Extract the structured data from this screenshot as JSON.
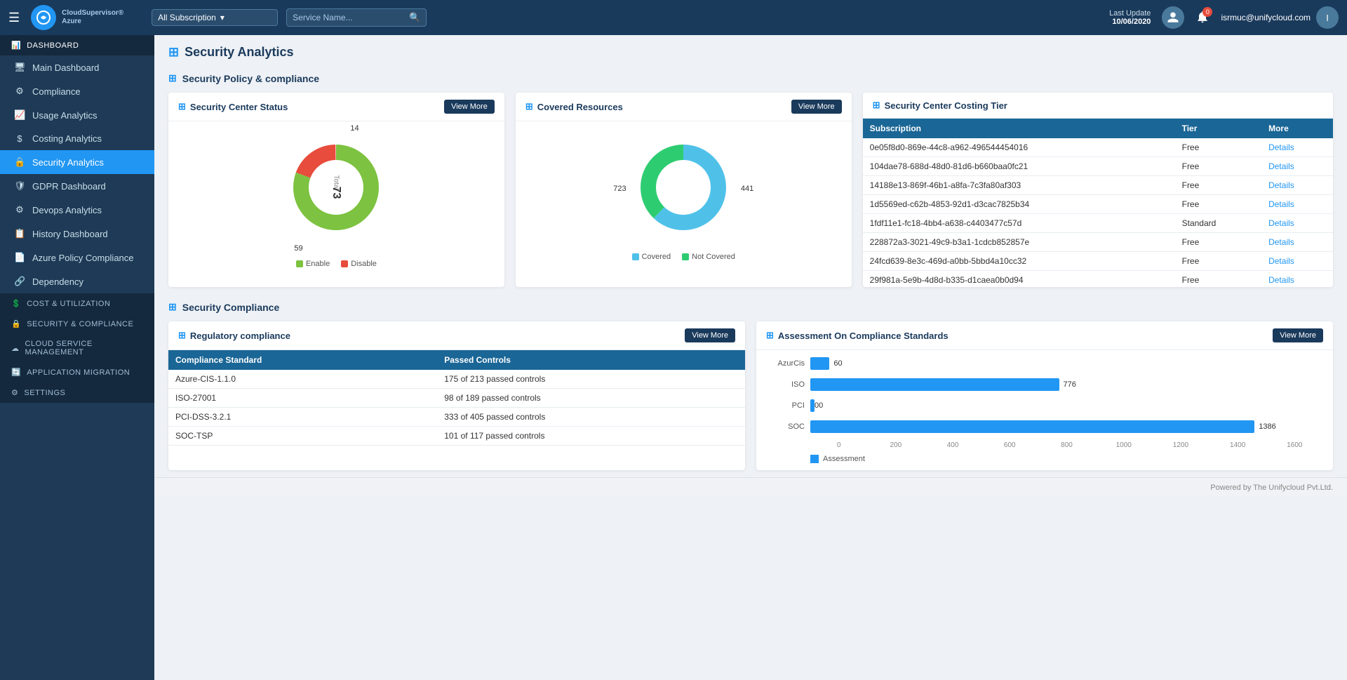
{
  "topnav": {
    "hamburger_icon": "☰",
    "logo_text": "CloudSupervisor®",
    "logo_sub": "Azure",
    "subscription_label": "All Subscription",
    "service_placeholder": "Service Name...",
    "last_update_label": "Last Update",
    "last_update_date": "10/06/2020",
    "username": "isrmuc@unifycloud.com",
    "bell_badge": "0"
  },
  "sidebar": {
    "dashboard_section": "Dashboard",
    "items": [
      {
        "id": "main-dashboard",
        "label": "Main Dashboard",
        "icon": "🖥"
      },
      {
        "id": "compliance",
        "label": "Compliance",
        "icon": "⚙"
      },
      {
        "id": "usage-analytics",
        "label": "Usage Analytics",
        "icon": "📈"
      },
      {
        "id": "costing-analytics",
        "label": "Costing Analytics",
        "icon": "$"
      },
      {
        "id": "security-analytics",
        "label": "Security Analytics",
        "icon": "🔒",
        "active": true
      },
      {
        "id": "gdpr-dashboard",
        "label": "GDPR Dashboard",
        "icon": "🛡"
      },
      {
        "id": "devops-analytics",
        "label": "Devops Analytics",
        "icon": "⚙"
      },
      {
        "id": "history-dashboard",
        "label": "History Dashboard",
        "icon": "📋"
      },
      {
        "id": "azure-policy",
        "label": "Azure Policy Compliance",
        "icon": "📄"
      },
      {
        "id": "dependency",
        "label": "Dependency",
        "icon": "🔗"
      }
    ],
    "sections": [
      {
        "id": "cost-utilization",
        "label": "Cost & Utilization",
        "icon": "💲"
      },
      {
        "id": "security-compliance",
        "label": "Security & Compliance",
        "icon": "🔒"
      },
      {
        "id": "cloud-service",
        "label": "Cloud Service Management",
        "icon": "☁"
      },
      {
        "id": "app-migration",
        "label": "Application Migration",
        "icon": "🔄"
      },
      {
        "id": "settings",
        "label": "Settings",
        "icon": "⚙"
      }
    ]
  },
  "page": {
    "title": "Security Analytics"
  },
  "security_policy_section": {
    "title": "Security Policy & compliance"
  },
  "security_center_status": {
    "card_title": "Security Center Status",
    "view_more": "View More",
    "total_label": "Total",
    "total_value": "73",
    "donut_segments": [
      {
        "label": "Enable",
        "value": 59,
        "color": "#7dc240",
        "percent": 80.8
      },
      {
        "label": "Disable",
        "value": 14,
        "color": "#e74c3c",
        "percent": 19.2
      }
    ],
    "label_enable": "Enable",
    "label_disable": "Disable",
    "value_top": "14",
    "value_bottom": "59"
  },
  "covered_resources": {
    "card_title": "Covered Resources",
    "view_more": "View More",
    "donut_segments": [
      {
        "label": "Covered",
        "value": 723,
        "color": "#4fc1e9",
        "percent": 62.1
      },
      {
        "label": "Not Covered",
        "value": 441,
        "color": "#2ecc71",
        "percent": 37.9
      }
    ],
    "label_covered": "Covered",
    "label_not_covered": "Not Covered",
    "value_left": "723",
    "value_right": "441"
  },
  "costing_tier": {
    "card_title": "Security Center Costing Tier",
    "col_subscription": "Subscription",
    "col_tier": "Tier",
    "col_more": "More",
    "rows": [
      {
        "subscription": "0e05f8d0-869e-44c8-a962-496544454016",
        "tier": "Free",
        "more": "Details"
      },
      {
        "subscription": "104dae78-688d-48d0-81d6-b660baa0fc21",
        "tier": "Free",
        "more": "Details"
      },
      {
        "subscription": "14188e13-869f-46b1-a8fa-7c3fa80af303",
        "tier": "Free",
        "more": "Details"
      },
      {
        "subscription": "1d5569ed-c62b-4853-92d1-d3cac7825b34",
        "tier": "Free",
        "more": "Details"
      },
      {
        "subscription": "1fdf11e1-fc18-4bb4-a638-c4403477c57d",
        "tier": "Standard",
        "more": "Details"
      },
      {
        "subscription": "228872a3-3021-49c9-b3a1-1cdcb852857e",
        "tier": "Free",
        "more": "Details"
      },
      {
        "subscription": "24fcd639-8e3c-469d-a0bb-5bbd4a10cc32",
        "tier": "Free",
        "more": "Details"
      },
      {
        "subscription": "29f981a-5e9b-4d8d-b335-d1caea0b0d94",
        "tier": "Free",
        "more": "Details"
      }
    ]
  },
  "security_compliance_section": {
    "title": "Security Compliance"
  },
  "regulatory_compliance": {
    "card_title": "Regulatory compliance",
    "view_more": "View More",
    "col_standard": "Compliance Standard",
    "col_passed": "Passed Controls",
    "rows": [
      {
        "standard": "Azure-CIS-1.1.0",
        "passed": "175 of 213 passed controls"
      },
      {
        "standard": "ISO-27001",
        "passed": "98 of 189 passed controls"
      },
      {
        "standard": "PCI-DSS-3.2.1",
        "passed": "333 of 405 passed controls"
      },
      {
        "standard": "SOC-TSP",
        "passed": "101 of 117 passed controls"
      }
    ]
  },
  "assessment_compliance": {
    "card_title": "Assessment On Compliance Standards",
    "view_more": "View More",
    "bars": [
      {
        "label": "AzurCis",
        "value": 60,
        "max": 1600
      },
      {
        "label": "ISO",
        "value": 776,
        "max": 1600
      },
      {
        "label": "PCI",
        "value": 0,
        "max": 1600
      },
      {
        "label": "SOC",
        "value": 1386,
        "max": 1600
      }
    ],
    "axis_labels": [
      "0",
      "200",
      "400",
      "600",
      "800",
      "1000",
      "1200",
      "1400",
      "1600"
    ],
    "legend_label": "Assessment"
  },
  "footer": {
    "text": "Powered by The Unifycloud Pvt.Ltd."
  }
}
